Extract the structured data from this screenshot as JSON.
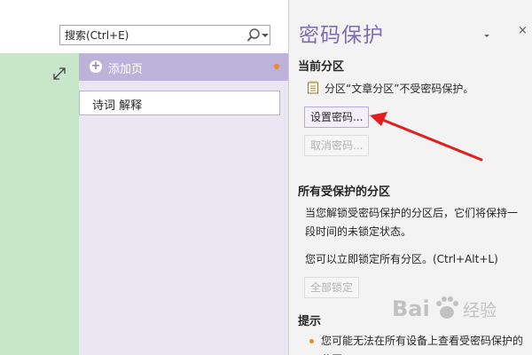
{
  "search": {
    "placeholder": "搜索(Ctrl+E)",
    "icon": "search-icon",
    "dropdown_icon": "chevron-down-icon"
  },
  "canvas": {
    "expand_icon": "expand-diagonal-icon",
    "section_color": "#c8e6c9"
  },
  "pages": {
    "add_page_label": "添加页",
    "add_page_icon": "plus-circle-icon",
    "items": [
      {
        "title": "诗词 解释"
      }
    ]
  },
  "pane": {
    "title": "密码保护",
    "menu_icon": "pane-options-icon",
    "close_label": "×",
    "current_section": {
      "heading": "当前分区",
      "icon": "notebook-section-icon",
      "status": "分区“文章分区”不受密码保护。",
      "set_password_label": "设置密码...",
      "remove_password_label": "取消密码..."
    },
    "all_sections": {
      "heading": "所有受保护的分区",
      "unlock_desc": "当您解锁受密码保护的分区后，它们将保持一段时间的未锁定状态。",
      "lock_all_desc": "您可以立即锁定所有分区。(Ctrl+Alt+L)",
      "lock_all_label": "全部锁定"
    },
    "tips": {
      "heading": "提示",
      "items": [
        "您可能无法在所有设备上查看受密码保护的分区"
      ]
    }
  },
  "annotation": {
    "arrow_color": "#e02020"
  },
  "watermark": {
    "text": "Bai",
    "paw_icon": "baidu-paw-icon",
    "suffix": "经验"
  },
  "colors": {
    "accent": "#7e6cb1",
    "add_page_bg": "#bdb3da",
    "page_pane_bg": "#eae7f2",
    "task_pane_bg": "#f3f3f3"
  }
}
